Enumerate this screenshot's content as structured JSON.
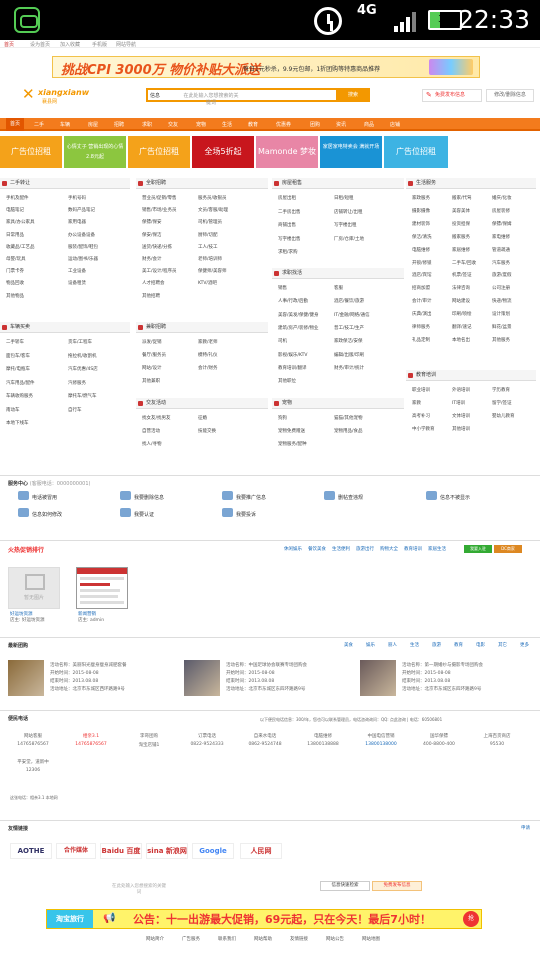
{
  "status_bar": {
    "time": "22:33",
    "network": "4G",
    "battery": "34"
  },
  "top_strip": {
    "items": [
      "首页",
      "设为首页",
      "加入收藏",
      "手机版",
      "网站导航"
    ]
  },
  "promo_banner": {
    "headline": "挑战CPI 3000万 物价补贴大派送",
    "sub": "每日1元秒杀，9.9元包邮，1折团购等特惠商品推荐"
  },
  "logo": {
    "en": "xiangxianw",
    "cn": "襄县网"
  },
  "search": {
    "category": "信息",
    "placeholder": "在此处输入您想搜索的关键词",
    "button": "搜索"
  },
  "header_buttons": {
    "publish": "免费发布信息",
    "edit": "修改/删除信息"
  },
  "nav": [
    "首页",
    "二手",
    "车辆",
    "房屋",
    "招聘",
    "求职",
    "交友",
    "宠物",
    "生活",
    "教育",
    "优惠券",
    "团购",
    "资讯",
    "商品",
    "店铺"
  ],
  "ads": [
    {
      "label": "广告位招租",
      "color": "#f4a21a"
    },
    {
      "label": "心情丈子 营销出现的心情 2.8元起",
      "color": "#8cc63f"
    },
    {
      "label": "广告位招租",
      "color": "#f4a21a"
    },
    {
      "label": "全场5折起",
      "color": "#c8161d"
    },
    {
      "label": "Mamonde 梦妆",
      "color": "#e886a6"
    },
    {
      "label": "家居家电特卖会 满就开场",
      "color": "#1a93d5"
    },
    {
      "label": "广告位招租",
      "color": "#3db3e3"
    }
  ],
  "sections": {
    "ershou": {
      "title": "二手转让",
      "links": [
        "手机及配件",
        "手机号码",
        "电脑笔记",
        "数码产品笔记",
        "家具/办公家具",
        "家用电器",
        "日常用品",
        "办公设备设备",
        "收藏品/工艺品",
        "服装/配饰/鞋包",
        "母婴/玩具",
        "运动/图书/乐器",
        "门票卡券",
        "工业设备",
        "物品回收",
        "设备租赁",
        "其他物品"
      ]
    },
    "cheliang": {
      "title": "车辆买卖",
      "links": [
        "二手轿车",
        "货车/工程车",
        "面包车/客车",
        "拖拉机/收割机",
        "摩托/电瓶车",
        "汽车优惠/4S店",
        "汽车用品/配件",
        "汽修服务",
        "车辆收购服务",
        "摩托车/燃气车",
        "南动车",
        "自行车",
        "本地下线车"
      ]
    },
    "quanzhi": {
      "title": "全职招聘",
      "links": [
        "营业员/促销/零售",
        "服务员/收银员",
        "销售/市场/业务员",
        "文员/客服/助理",
        "保镖/保安",
        "司机/管理员",
        "保安/保洁",
        "厨师/切配",
        "送货/快递/分拣",
        "工人/技工",
        "财务/会计",
        "老师/培训师",
        "美工/设计/程序员",
        "保健师/美容师",
        "人才招聘会",
        "KTV/酒吧",
        "其他招聘"
      ]
    },
    "jianzhi": {
      "title": "兼职招聘",
      "links": [
        "派发/促销",
        "家教/老师",
        "餐厅/服务员",
        "模特/礼仪",
        "网站/设计",
        "会计/财务",
        "其他兼职"
      ]
    },
    "jiaoyou": {
      "title": "交友活动",
      "links": [
        "找女友/找男友",
        "征婚",
        "自营活动",
        "技能交换",
        "找人/寻物"
      ]
    },
    "fangwu": {
      "title": "房屋租售",
      "links": [
        "房屋出租",
        "日租/短租",
        "二手房出售",
        "店铺转让/出租",
        "商铺出售",
        "写字楼出租",
        "写字楼出售",
        "厂房/仓库/土地",
        "求租/求购"
      ]
    },
    "qiuzhi": {
      "title": "求职找活",
      "links": [
        "销售",
        "客服",
        "人事/行政/后勤",
        "酒店/餐饮/旅游",
        "美容/美发/保健/健身",
        "IT/金融/网络/通信",
        "建筑/房产/装修/物业",
        "普工/技工/生产",
        "司机",
        "家政保洁/安保",
        "影视/娱乐/KTV",
        "编辑/出版/印刷",
        "教育培训/翻译",
        "财务/审计/统计",
        "其他职位"
      ]
    },
    "chongwu": {
      "title": "宠物",
      "links": [
        "狗狗",
        "猫猫/其他宠物",
        "宠物免费赠送",
        "宠物用品/食品",
        "宠物服务/配种"
      ]
    },
    "shenghuo": {
      "title": "生活服务",
      "links": [
        "家政服务",
        "搬家/代驾",
        "婚庆/化妆",
        "摄影摄像",
        "美容美体",
        "房屋装修",
        "建材装饰",
        "投资担保",
        "保镖/保姆",
        "保洁/清洗",
        "搬家服务",
        "家电维修",
        "电脑维修",
        "家居维修",
        "管道疏通",
        "开锁/修锁",
        "二手车/回收",
        "汽车服务",
        "酒店/宾馆",
        "机票/签证",
        "旅游/度假",
        "招商加盟",
        "法律咨询",
        "公司注册",
        "会计/审计",
        "网站建设",
        "快递/物流",
        "庆典/演出",
        "印刷/喷绘",
        "设计策划",
        "律师服务",
        "翻译/速记",
        "鲜花/盆景",
        "礼品定制",
        "本地名出",
        "其他服务"
      ]
    },
    "jiaoyu": {
      "title": "教育培训",
      "links": [
        "职业培训",
        "外语培训",
        "学历教育",
        "家教",
        "IT培训",
        "留学/签证",
        "高考补习",
        "文体培训",
        "婴幼儿教育",
        "中小学教育",
        "其他培训"
      ]
    }
  },
  "service_center": {
    "title": "服务中心",
    "hotline": "(客服电话：0000000001)",
    "items": [
      "电话被冒用",
      "我要删除信息",
      "我要推广信息",
      "删帖查违规",
      "信息不被显示",
      "信息如何修改",
      "我要认证",
      "我要投诉"
    ]
  },
  "hot_stores": {
    "title": "火热促销排行",
    "tags": [
      "休闲娱乐",
      "餐饮美食",
      "生活便利",
      "旅游出行",
      "购物大全",
      "教育培训",
      "家居生活"
    ],
    "btn1": "我要入驻",
    "btn2": "DC商家",
    "shops": [
      {
        "noimg": "暂无图片",
        "name": "好运坊资源",
        "owner": "店主: 好运坊资源"
      },
      {
        "name": "新闻营销",
        "owner": "店主: admin"
      }
    ]
  },
  "recent_groupbuy": {
    "title": "最新团购",
    "cats": [
      "美食",
      "娱乐",
      "丽人",
      "生活",
      "旅游",
      "教育",
      "电影",
      "其它",
      "更多"
    ],
    "posts": [
      {
        "name": "活动名称：美丽阳光瘦身瘦身减肥套餐",
        "start": "开始时间：2015-08-08",
        "end": "结束时间：2013.08.08",
        "addr": "活动地址：北京市东城区西环路路9号"
      },
      {
        "name": "活动名称：中国足球协会联赛专场团购会",
        "start": "开始时间：2015-08-08",
        "end": "结束时间：2013.08.08",
        "addr": "活动地址：北京市东城区东四环路路9号"
      },
      {
        "name": "活动名称：第一期婚纱与摄影专场团购会",
        "start": "开始时间：2015-08-08",
        "end": "结束时间：2013.08.08",
        "addr": "活动地址：北京市东城区东四环路路9号"
      }
    ]
  },
  "phones": {
    "title": "便民电话",
    "notice": "以下便民电话信息：300/年，您也可以联系管理员，电话咨询询问：QQ: 点此咨询 | 电话：60506801",
    "items": [
      {
        "name": "网站客服",
        "num": "14765876567"
      },
      {
        "name": "相亲3.1",
        "num": "14765876567"
      },
      {
        "name": "李哥团购",
        "num": "淘宝店铺1"
      },
      {
        "name": "订票电话",
        "num": "0822-9524333"
      },
      {
        "name": "自来水电话",
        "num": "0862-9524748"
      },
      {
        "name": "电脑维修",
        "num": "13800138888"
      },
      {
        "name": "中国电信营销",
        "num": "13800138000"
      },
      {
        "name": "国华保镖",
        "num": "400-8800-400"
      },
      {
        "name": "上海百货商店",
        "num": "95530"
      },
      {
        "name": "平安堂，道新中",
        "num": "12306"
      }
    ],
    "footnote": "这张电话：相亲3.1 本地网"
  },
  "friend_links": {
    "title": "友情链接",
    "more": "申请",
    "logos": [
      "AOTHE",
      "合作媒体",
      "Baidu 百度",
      "sina 新浪网",
      "Google",
      "人民网"
    ]
  },
  "bottom_search": {
    "placeholder": "在此处输入您想搜索的关键词",
    "btn1": "信息快速检索",
    "btn2": "免费发布信息"
  },
  "taobao_banner": {
    "brand": "淘宝旅行",
    "text": "公告：十一出游最大促销，69元起，只在今天！最后7小时！",
    "go": "抢"
  },
  "footer": [
    "网站简介",
    "广告服务",
    "联系我们",
    "网站帮助",
    "友情链接",
    "网站公告",
    "网站地图"
  ]
}
